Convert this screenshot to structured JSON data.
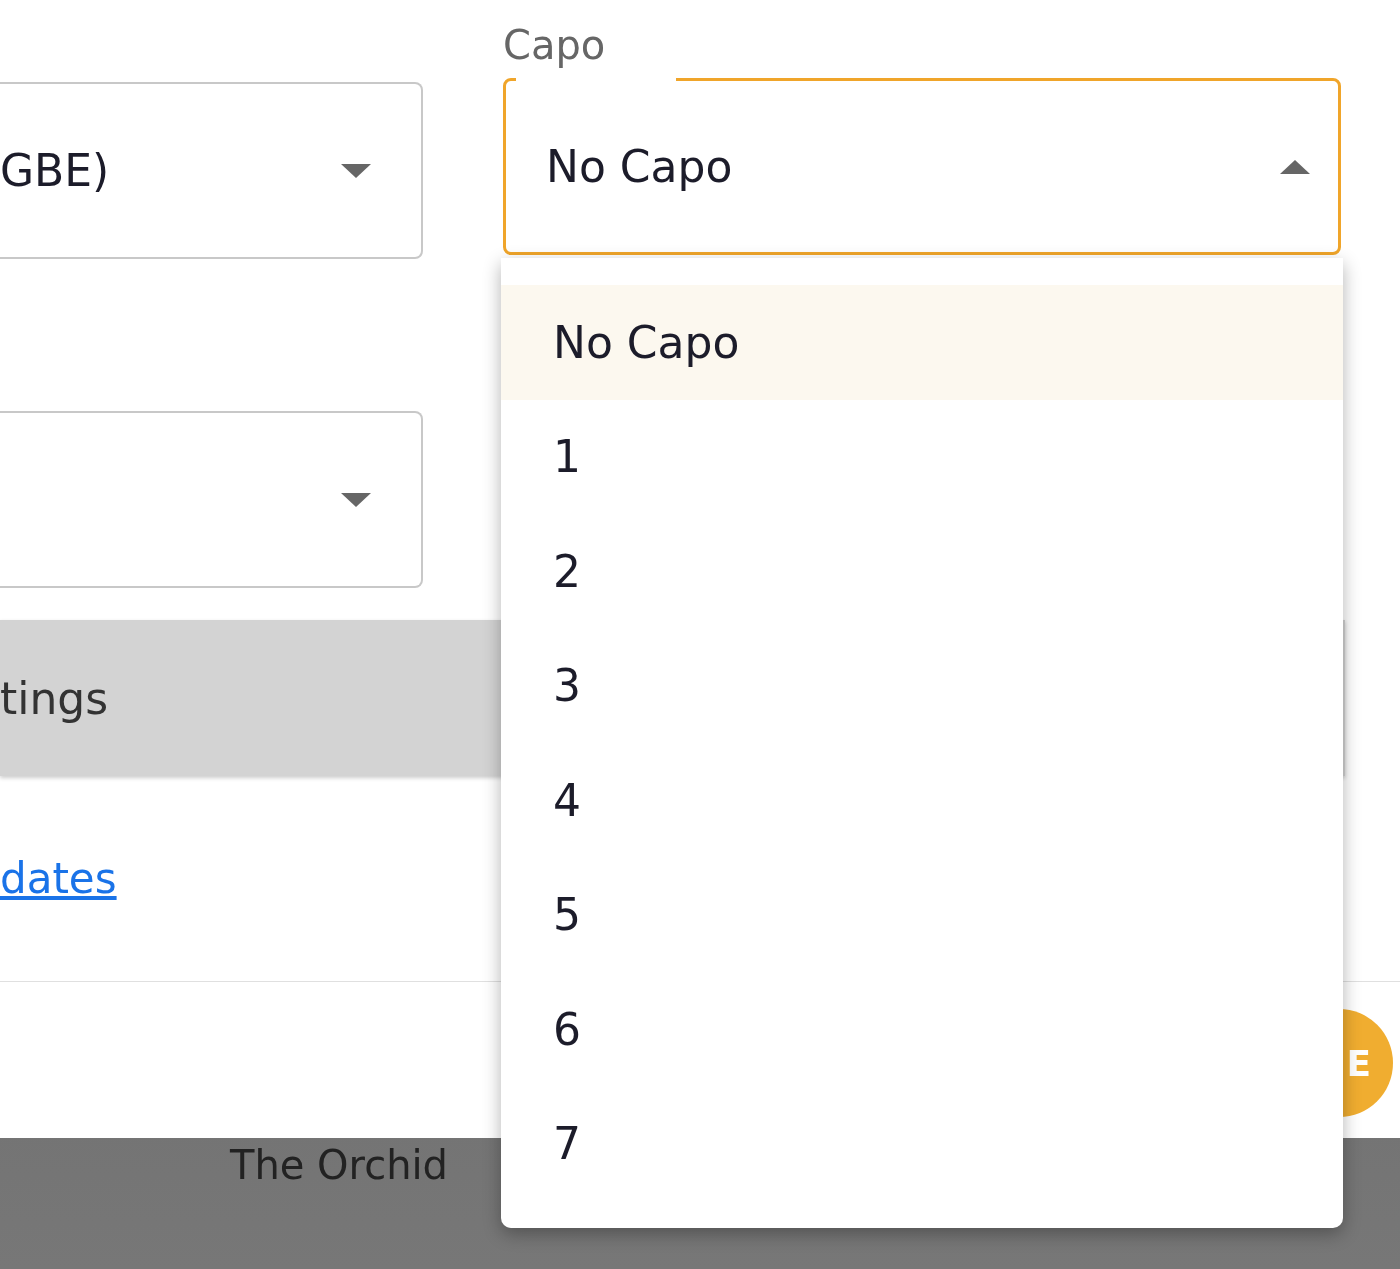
{
  "fields": [
    {
      "kind": "filled",
      "value": "GBE)"
    },
    {
      "kind": "blank"
    }
  ],
  "capo": {
    "label": "Capo",
    "value": "No Capo",
    "expanded": true,
    "options": [
      {
        "label": "No Capo",
        "selected": true
      },
      {
        "label": "1",
        "selected": false
      },
      {
        "label": "2",
        "selected": false
      },
      {
        "label": "3",
        "selected": false
      },
      {
        "label": "4",
        "selected": false
      },
      {
        "label": "5",
        "selected": false
      },
      {
        "label": "6",
        "selected": false
      },
      {
        "label": "7",
        "selected": false
      }
    ]
  },
  "settings_bar": {
    "label": "tings"
  },
  "link": {
    "label": "dates"
  },
  "avatar": {
    "initial": "E"
  },
  "footer": {
    "text": "The Orchid"
  }
}
